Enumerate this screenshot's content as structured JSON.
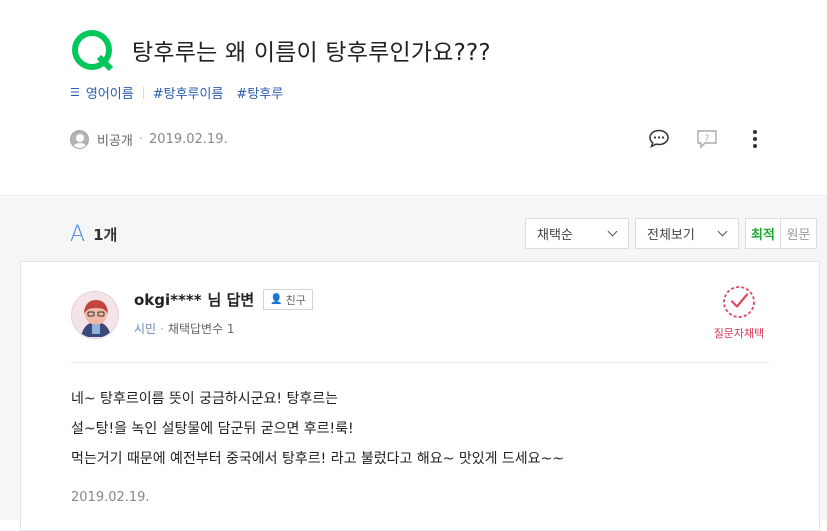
{
  "question": {
    "title": "탕후루는 왜 이름이 탕후루인가요???",
    "category": "영어이름",
    "tags": [
      "#탕후루이름",
      "#탕후루"
    ],
    "author": "비공개",
    "date": "2019.02.19.",
    "accent_color": "#03c75a"
  },
  "answers": {
    "letter": "A",
    "count": "1개",
    "sort_select": "채택순",
    "filter_select": "전체보기",
    "toggle": {
      "active": "최적",
      "other": "원문"
    },
    "item": {
      "name": "okgi****",
      "suffix": "님 답변",
      "friend_label": "친구",
      "level": "시민",
      "adopted": "채택답변수 1",
      "chosen_label": "질문자채택",
      "lines": [
        "네~ 탕후르이름 뜻이 궁금하시군요! 탕후르는",
        "설~탕!을 녹인 설탕물에 담군뒤 굳으면 후르!룩!",
        "먹는거기 때문에 예전부터 중국에서 탕후르! 라고 불렀다고 해요~ 맛있게 드세요~~"
      ],
      "date": "2019.02.19."
    }
  }
}
